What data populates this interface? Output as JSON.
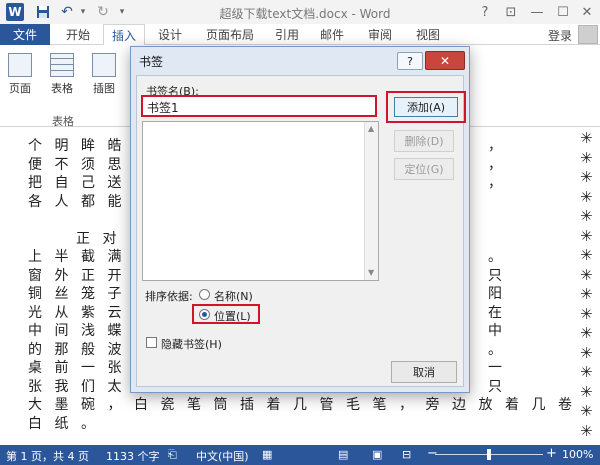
{
  "window": {
    "title": "超级下载text文档.docx - Word",
    "app_logo": "W",
    "help": "?",
    "restore": "⊡",
    "minimize": "—",
    "maximize": "☐",
    "close": "✕"
  },
  "tabs": [
    {
      "label": "文件"
    },
    {
      "label": "开始"
    },
    {
      "label": "插入"
    },
    {
      "label": "设计"
    },
    {
      "label": "页面布局"
    },
    {
      "label": "引用"
    },
    {
      "label": "邮件"
    },
    {
      "label": "审阅"
    },
    {
      "label": "视图"
    }
  ],
  "account": {
    "login": "登录"
  },
  "ribbon": {
    "page": "页面",
    "table": "表格",
    "picture": "插图",
    "group_table": "表格"
  },
  "document": {
    "lines": [
      "个明眸皓",
      "便不须思",
      "把自己送",
      "各人都能",
      "",
      "正对",
      "上半截满",
      "窗外正开",
      "铜丝笼子",
      "光从紫云",
      "中间浅蝶",
      "的那般波",
      "桌前一张",
      "张我们太",
      "大墨碗，白瓷笔筒插着几管毛笔，旁边放着几卷",
      "白纸。"
    ],
    "right_tail": [
      {
        "row": 0,
        "text": "，"
      },
      {
        "row": 1,
        "text": "，"
      },
      {
        "row": 2,
        "text": "，"
      },
      {
        "row": 6,
        "text": "。"
      },
      {
        "row": 7,
        "text": "只"
      },
      {
        "row": 8,
        "text": "阳"
      },
      {
        "row": 9,
        "text": "在"
      },
      {
        "row": 10,
        "text": "中"
      },
      {
        "row": 11,
        "text": "。"
      },
      {
        "row": 12,
        "text": "一"
      },
      {
        "row": 13,
        "text": "只"
      }
    ],
    "deco_glyph": "✳"
  },
  "dialog": {
    "title": "书签",
    "help": "?",
    "close": "✕",
    "name_label": "书签名(B):",
    "name_value": "书签1",
    "add": "添加(A)",
    "delete": "删除(D)",
    "goto": "定位(G)",
    "sort_label": "排序依据:",
    "sort_name": "名称(N)",
    "sort_position": "位置(L)",
    "hidden": "隐藏书签(H)",
    "cancel": "取消"
  },
  "status": {
    "page": "第 1 页，共 4 页",
    "words": "1133 个字",
    "language": "中文(中国)",
    "zoom": "100%",
    "zoom_minus": "−",
    "zoom_plus": "+"
  }
}
